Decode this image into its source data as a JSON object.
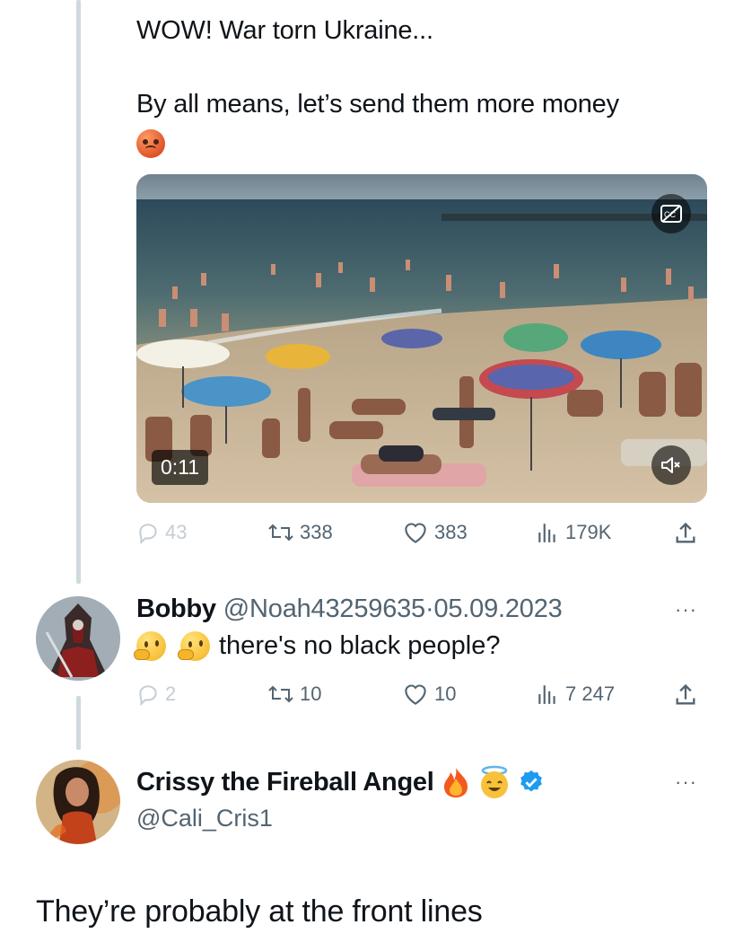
{
  "original_tweet": {
    "line1": "WOW! War torn Ukraine...",
    "line2": "By all means, let’s send them more money",
    "emoji": "angry-face-emoji",
    "video": {
      "duration": "0:11",
      "cc_icon": "closed-captions-icon",
      "mute_icon": "speaker-muted-icon"
    },
    "stats": {
      "replies": "43",
      "reposts": "338",
      "likes": "383",
      "views": "179K"
    }
  },
  "reply": {
    "name": "Bobby",
    "handle": "@Noah43259635",
    "separator": "·",
    "date": "05.09.2023",
    "text": "there's no black people?",
    "emojis": [
      "thinking-face-emoji",
      "thinking-face-emoji"
    ],
    "more": "···",
    "stats": {
      "replies": "2",
      "reposts": "10",
      "likes": "10",
      "views": "7 247"
    }
  },
  "second_reply": {
    "name": "Crissy the Fireball Angel",
    "handle": "@Cali_Cris1",
    "badges": [
      "fire-emoji",
      "smiling-face-with-halo-emoji",
      "verified-badge-icon"
    ],
    "more": "···",
    "text": "They’re probably at the front lines"
  },
  "colors": {
    "text": "#0f1419",
    "secondary": "#536471",
    "muted": "#c4cdd3",
    "thread_line": "#cfd9de",
    "verified": "#1d9bf0"
  }
}
